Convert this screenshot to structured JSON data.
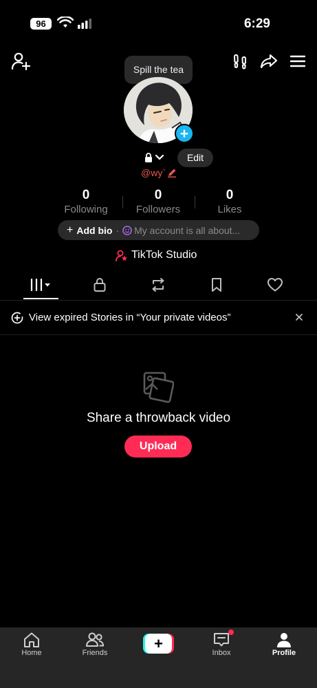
{
  "status_bar": {
    "battery": "96",
    "time": "6:29"
  },
  "tooltip": {
    "text": "Spill the tea"
  },
  "profile": {
    "edit_label": "Edit",
    "handle": "@wy`"
  },
  "stats": [
    {
      "value": "0",
      "label": "Following"
    },
    {
      "value": "0",
      "label": "Followers"
    },
    {
      "value": "0",
      "label": "Likes"
    }
  ],
  "bio": {
    "add_label": "Add bio",
    "placeholder": "My account is all about..."
  },
  "studio": {
    "label": "TikTok Studio"
  },
  "tabs": [
    {
      "icon": "grid-icon",
      "active": true
    },
    {
      "icon": "lock-icon"
    },
    {
      "icon": "repost-icon"
    },
    {
      "icon": "bookmark-icon"
    },
    {
      "icon": "heart-icon"
    }
  ],
  "banner": {
    "text": "View expired Stories in “Your private videos”"
  },
  "empty_state": {
    "title": "Share a throwback video",
    "button": "Upload"
  },
  "nav": {
    "items": [
      {
        "label": "Home",
        "icon": "home-icon"
      },
      {
        "label": "Friends",
        "icon": "friends-icon"
      },
      {
        "label": "",
        "icon": "create-icon"
      },
      {
        "label": "Inbox",
        "icon": "inbox-icon"
      },
      {
        "label": "Profile",
        "icon": "profile-icon",
        "active": true
      }
    ]
  },
  "colors": {
    "accent": "#fe2c55",
    "blue": "#1ab6f0",
    "handle": "#e8554d",
    "bg": "#000000",
    "nav_bg": "#262626"
  }
}
